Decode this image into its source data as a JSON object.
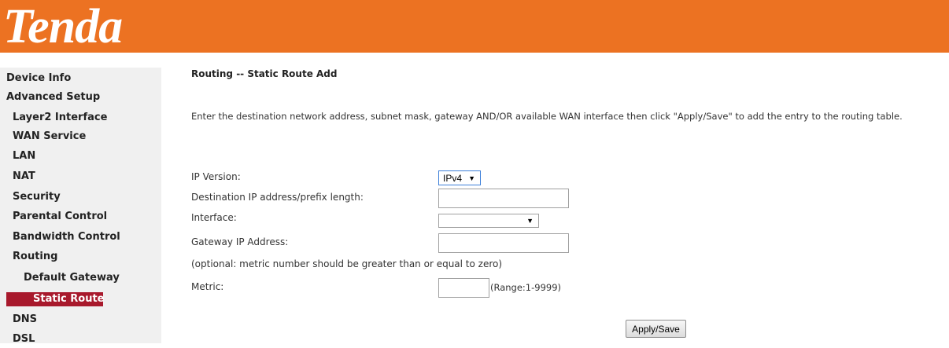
{
  "brand": {
    "logo_text": "Tenda",
    "header_color": "#ec7222"
  },
  "sidebar": {
    "items": [
      {
        "label": "Device Info"
      },
      {
        "label": "Advanced Setup"
      },
      {
        "label": "Layer2 Interface"
      },
      {
        "label": "WAN Service"
      },
      {
        "label": "LAN"
      },
      {
        "label": "NAT"
      },
      {
        "label": "Security"
      },
      {
        "label": "Parental Control"
      },
      {
        "label": "Bandwidth Control"
      },
      {
        "label": "Routing"
      },
      {
        "label": "Default Gateway"
      },
      {
        "label": "Static Route"
      },
      {
        "label": "DNS"
      },
      {
        "label": "DSL"
      }
    ],
    "active_item": "Static Route",
    "active_color": "#a8192c"
  },
  "main": {
    "title": "Routing -- Static Route Add",
    "instructions": "Enter the destination network address, subnet mask, gateway AND/OR available WAN interface then click \"Apply/Save\" to add the entry to the routing table.",
    "form": {
      "ip_version_label": "IP Version:",
      "ip_version_value": "IPv4",
      "destination_label": "Destination IP address/prefix length:",
      "destination_value": "",
      "interface_label": "Interface:",
      "interface_value": "",
      "gateway_label": "Gateway IP Address:",
      "gateway_value": "",
      "optional_note": "(optional: metric number should be greater than or equal to zero)",
      "metric_label": "Metric:",
      "metric_value": "",
      "metric_range": "(Range:1-9999)"
    },
    "apply_label": "Apply/Save"
  }
}
